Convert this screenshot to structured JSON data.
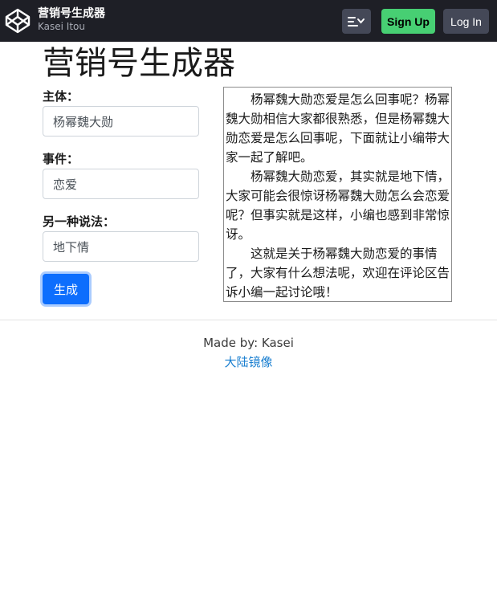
{
  "header": {
    "logo_icon": "codepen-logo-icon",
    "title": "营销号生成器",
    "author": "Kasei Itou",
    "menu_icon": "view-toggle-icon",
    "signup_label": "Sign Up",
    "login_label": "Log In",
    "colors": {
      "bar": "#1e1f26",
      "signup": "#47cf73",
      "secondary_button": "#444857"
    }
  },
  "main": {
    "title": "营销号生成器",
    "form": {
      "subject_label": "主体：",
      "subject_value": "杨幂魏大勋",
      "event_label": "事件：",
      "event_value": "恋爱",
      "alt_label": "另一种说法：",
      "alt_value": "地下情",
      "generate_label": "生成",
      "button_color": "#0d6efd"
    },
    "output": {
      "paragraphs": [
        "杨幂魏大勋恋爱是怎么回事呢？杨幂魏大勋相信大家都很熟悉，但是杨幂魏大勋恋爱是怎么回事呢，下面就让小编带大家一起了解吧。",
        "杨幂魏大勋恋爱，其实就是地下情，大家可能会很惊讶杨幂魏大勋怎么会恋爱呢？但事实就是这样，小编也感到非常惊讶。",
        "这就是关于杨幂魏大勋恋爱的事情了，大家有什么想法呢，欢迎在评论区告诉小编一起讨论哦！"
      ]
    }
  },
  "footer": {
    "made_by": "Made by: Kasei",
    "mirror_link": "大陆镜像",
    "link_color": "#1a7fd0"
  }
}
